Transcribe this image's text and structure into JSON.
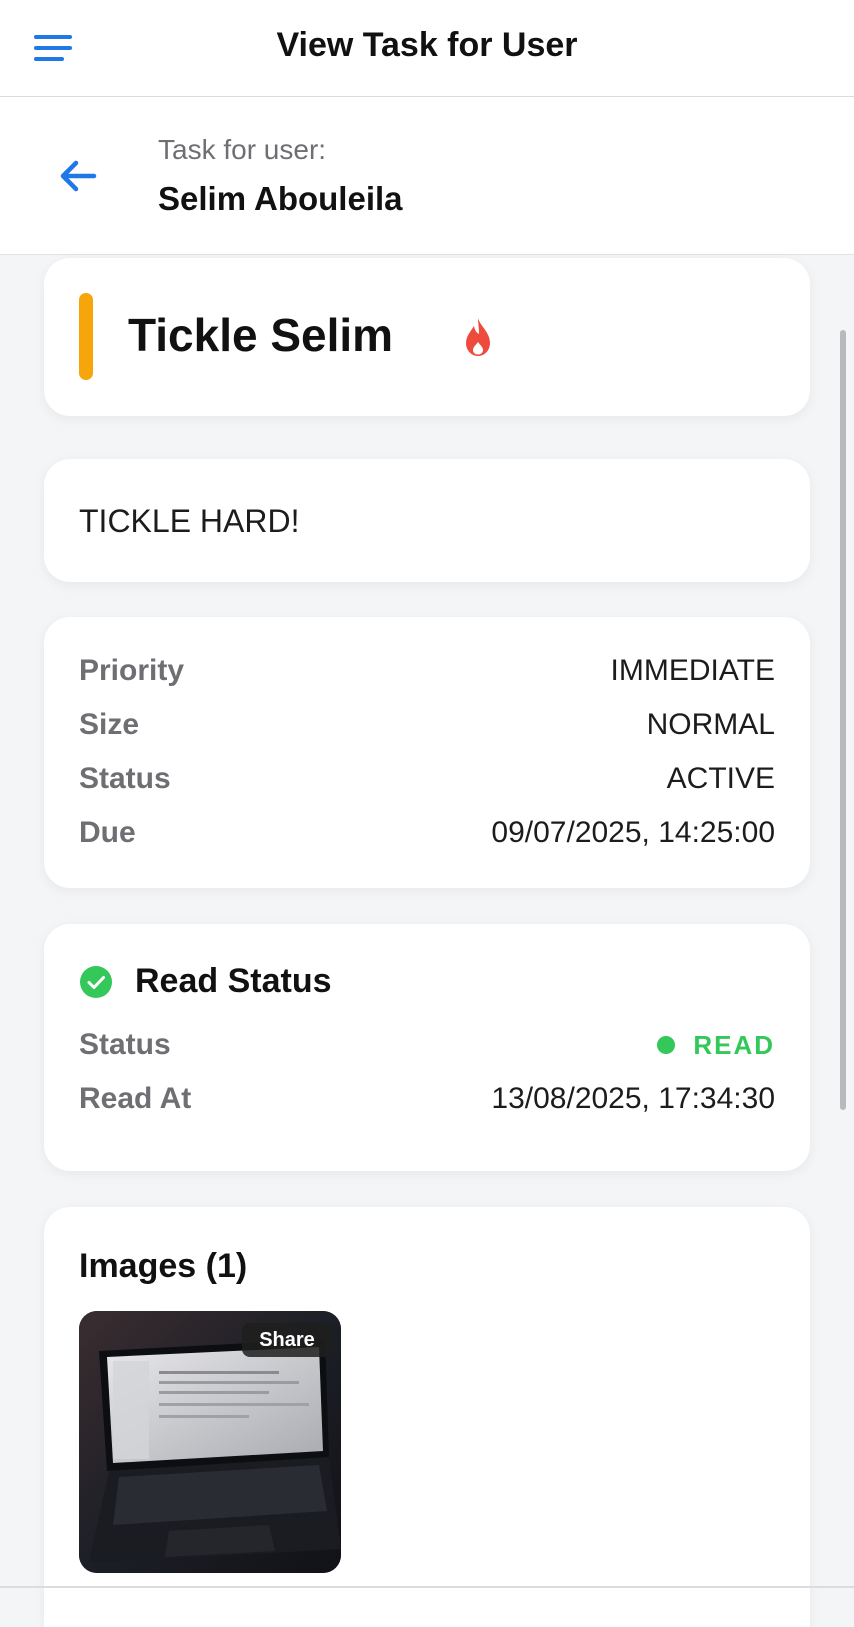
{
  "header": {
    "title": "View Task for User",
    "menu_icon": "hamburger-menu-icon"
  },
  "subheader": {
    "back_icon": "arrow-left-icon",
    "label": "Task for user:",
    "user_name": "Selim Abouleila"
  },
  "task": {
    "title": "Tickle Selim",
    "priority_icon": "flame-icon",
    "accent_color": "#f6a50b",
    "description": "TICKLE HARD!"
  },
  "details": [
    {
      "key": "Priority",
      "value": "IMMEDIATE"
    },
    {
      "key": "Size",
      "value": "NORMAL"
    },
    {
      "key": "Status",
      "value": "ACTIVE"
    },
    {
      "key": "Due",
      "value": "09/07/2025, 14:25:00"
    }
  ],
  "read_status": {
    "title": "Read Status",
    "icon": "check-circle-icon",
    "status_key": "Status",
    "status_value": "READ",
    "status_color": "#34c759",
    "read_at_key": "Read At",
    "read_at_value": "13/08/2025, 17:34:30"
  },
  "images": {
    "title": "Images (1)",
    "share_label": "Share",
    "thumbnail_icon": "laptop-photo-thumbnail"
  },
  "colors": {
    "primary": "#1f78e6",
    "background": "#f4f5f7"
  }
}
